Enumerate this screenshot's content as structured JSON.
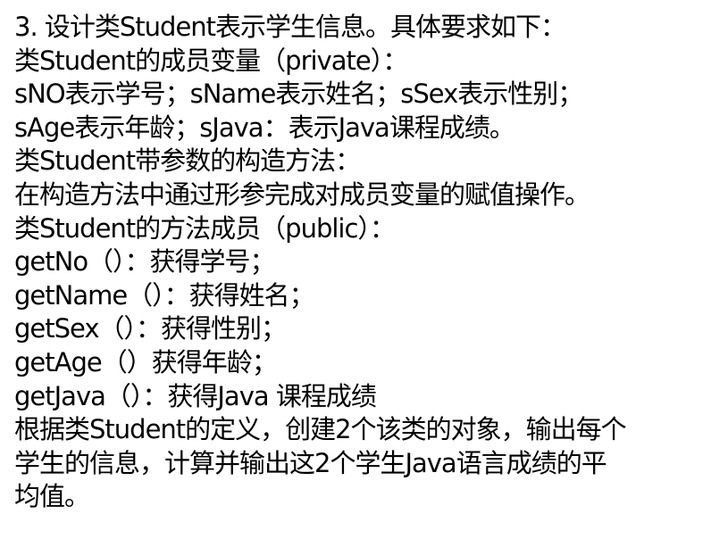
{
  "document": {
    "lines": [
      "3. 设计类Student表示学生信息。具体要求如下：",
      "类Student的成员变量（private）：",
      "sNO表示学号；sName表示姓名；sSex表示性别；",
      "sAge表示年龄；sJava：表示Java课程成绩。",
      "类Student带参数的构造方法：",
      "在构造方法中通过形参完成对成员变量的赋值操作。",
      "类Student的方法成员（public）：",
      "getNo（）：获得学号；",
      "getName（）：获得姓名；",
      "getSex（）：获得性别；",
      "getAge（）获得年龄；",
      "getJava（）：获得Java 课程成绩",
      "根据类Student的定义，创建2个该类的对象，输出每个",
      "学生的信息，计算并输出这2个学生Java语言成绩的平",
      "均值。"
    ]
  }
}
